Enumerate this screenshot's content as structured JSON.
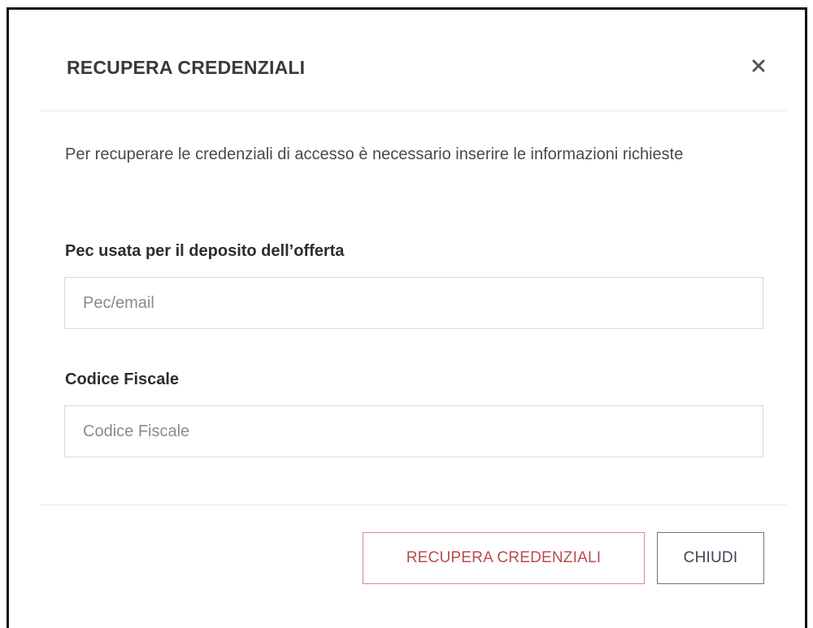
{
  "modal": {
    "title": "RECUPERA CREDENZIALI",
    "close_icon": "close-icon",
    "intro_text": "Per recuperare le credenziali di accesso è necessario inserire le informazioni richieste"
  },
  "form": {
    "pec": {
      "label": "Pec usata per il deposito dell’offerta",
      "value": "",
      "placeholder": "Pec/email"
    },
    "codice_fiscale": {
      "label": "Codice Fiscale",
      "value": "",
      "placeholder": "Codice Fiscale"
    }
  },
  "footer": {
    "recupera_label": "RECUPERA CREDENZIALI",
    "chiudi_label": "CHIUDI"
  },
  "colors": {
    "primary_outline": "#d88b8b",
    "primary_text": "#b84c4c",
    "secondary_outline": "#6e7580",
    "frame": "#111111"
  }
}
